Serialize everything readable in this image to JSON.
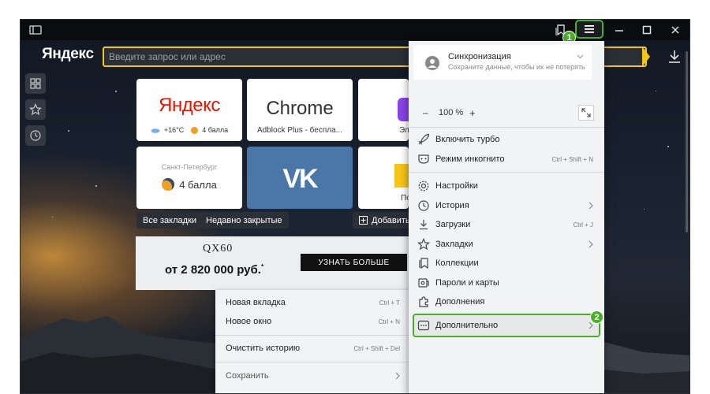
{
  "browser": {
    "logo": "Яндекс",
    "address_placeholder": "Введите запрос или адрес"
  },
  "badges": {
    "one": "1",
    "two": "2"
  },
  "tiles": {
    "yandex": {
      "title": "Яндекс",
      "temp": "+16°C",
      "score": "4 балла"
    },
    "chrome": {
      "title": "Chrome",
      "subtitle": "Adblock Plus - бесплa..."
    },
    "partial_top": {
      "subtitle": "Эл"
    },
    "spb": {
      "city": "Санкт-Петербург",
      "score": "4 балла"
    },
    "vk": {
      "logo": "VK"
    },
    "partial_bottom": {
      "subtitle": "По"
    }
  },
  "chips": {
    "bookmarks": "Все закладки",
    "recent": "Недавно закрытые",
    "add": "Добавить"
  },
  "ad": {
    "model": "QX60",
    "price": "от 2 820 000 руб.",
    "price_mark": "*",
    "cta": "УЗНАТЬ БОЛЬШЕ"
  },
  "context_menu": {
    "new_tab": {
      "label": "Новая вкладка",
      "shortcut": "Ctrl + T"
    },
    "new_window": {
      "label": "Новое окно",
      "shortcut": "Ctrl + N"
    },
    "clear_history": {
      "label": "Очистить историю",
      "shortcut": "Ctrl + Shift + Del"
    },
    "save": {
      "label": "Сохранить"
    }
  },
  "main_menu": {
    "sync": {
      "title": "Синхронизация",
      "subtitle": "Сохраните данные, чтобы их не потерять"
    },
    "zoom": {
      "minus": "–",
      "value": "100 %",
      "plus": "+"
    },
    "turbo": "Включить турбо",
    "incognito": {
      "label": "Режим инкогнито",
      "shortcut": "Ctrl + Shift + N"
    },
    "settings": "Настройки",
    "history": "История",
    "downloads": {
      "label": "Загрузки",
      "shortcut": "Ctrl + J"
    },
    "bookmarks": "Закладки",
    "collections": "Коллекции",
    "passwords": "Пароли и карты",
    "extensions": "Дополнения",
    "more": "Дополнительно"
  },
  "colors": {
    "accent_yellow": "#f5c518",
    "highlight_green": "#4caf2a",
    "yandex_red": "#e61400",
    "vk_blue": "#4a76a8"
  }
}
